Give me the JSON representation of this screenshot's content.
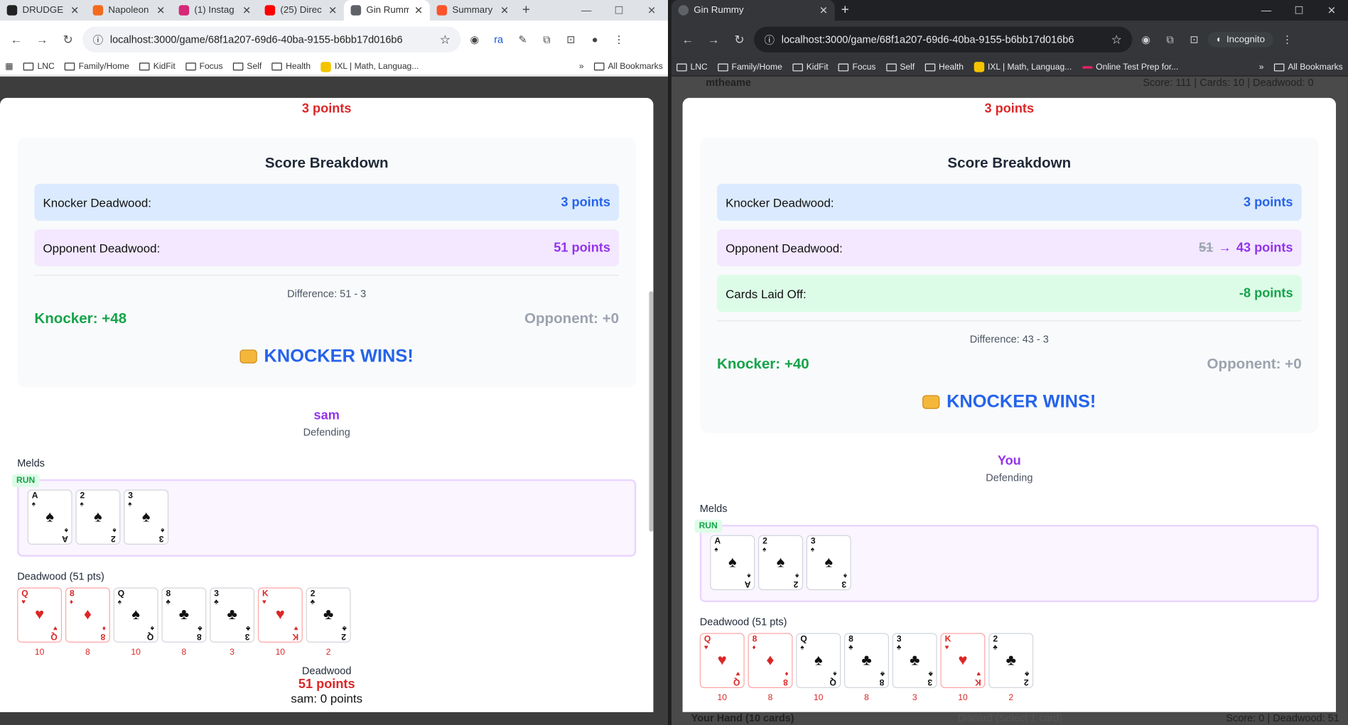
{
  "left_window": {
    "tabs": [
      {
        "title": "DRUDGE",
        "icon": "drudge-icon",
        "color": "#222222"
      },
      {
        "title": "Napoleon",
        "icon": "flame-icon",
        "color": "#f26b1d"
      },
      {
        "title": "(1) Instag",
        "icon": "instagram-icon",
        "color": "#d62976"
      },
      {
        "title": "(25) Direc",
        "icon": "youtube-icon",
        "color": "#ff0000"
      },
      {
        "title": "Gin Rumm",
        "icon": "globe-icon",
        "color": "#5f6368"
      },
      {
        "title": "Summary",
        "icon": "brave-icon",
        "color": "#fb542b"
      }
    ],
    "url": "localhost:3000/game/68f1a207-69d6-40ba-9155-b6bb17d016b6",
    "bookmarks": [
      "LNC",
      "Family/Home",
      "KidFit",
      "Focus",
      "Self",
      "Health",
      "IXL | Math, Languag..."
    ],
    "all_bookmarks": "All Bookmarks",
    "more": "»",
    "extensions": [
      "ra"
    ],
    "modal": {
      "top_points": "3 points",
      "breakdown_title": "Score Breakdown",
      "knocker_label": "Knocker Deadwood:",
      "knocker_value": "3 points",
      "opponent_label": "Opponent Deadwood:",
      "opponent_value": "51 points",
      "difference": "Difference: 51 - 3",
      "knocker_score": "Knocker: +48",
      "opponent_score": "Opponent: +0",
      "wins": "KNOCKER WINS!",
      "player_name": "sam",
      "player_role": "Defending",
      "melds_label": "Melds",
      "run_label": "RUN",
      "deadwood_label": "Deadwood (51 pts)",
      "footer_label": "Deadwood",
      "footer_points": "51 points",
      "footer_sam": "sam: 0 points"
    }
  },
  "right_window": {
    "tab_title": "Gin Rummy",
    "url": "localhost:3000/game/68f1a207-69d6-40ba-9155-b6bb17d016b6",
    "incognito": "Incognito",
    "bookmarks": [
      "LNC",
      "Family/Home",
      "KidFit",
      "Focus",
      "Self",
      "Health",
      "IXL | Math, Languag...",
      "Online Test Prep for..."
    ],
    "all_bookmarks": "All Bookmarks",
    "more": "»",
    "modal": {
      "top_points": "3 points",
      "breakdown_title": "Score Breakdown",
      "knocker_label": "Knocker Deadwood:",
      "knocker_value": "3 points",
      "opponent_label": "Opponent Deadwood:",
      "opponent_old": "51",
      "opponent_arrow": "→",
      "opponent_value": "43 points",
      "laid_off_label": "Cards Laid Off:",
      "laid_off_value": "-8 points",
      "difference": "Difference: 43 - 3",
      "knocker_score": "Knocker: +40",
      "opponent_score": "Opponent: +0",
      "wins": "KNOCKER WINS!",
      "player_name": "You",
      "player_role": "Defending",
      "melds_label": "Melds",
      "run_label": "RUN",
      "deadwood_label": "Deadwood (51 pts)"
    },
    "peek_top": "mtheame",
    "peek_top_right": "Score: 111 | Cards: 10 | Deadwood: 0",
    "peek_bottom_left": "Your Hand (10 cards)",
    "peek_bottom_mid": "Discard (Select 1 card)",
    "peek_bottom_right": "Score: 0 | Deadwood: 51"
  },
  "meld_cards": [
    {
      "rank": "A",
      "suit": "♠",
      "color": "black"
    },
    {
      "rank": "2",
      "suit": "♠",
      "color": "black"
    },
    {
      "rank": "3",
      "suit": "♠",
      "color": "black"
    }
  ],
  "deadwood_cards": [
    {
      "rank": "Q",
      "suit": "♥",
      "color": "red",
      "points": "10"
    },
    {
      "rank": "8",
      "suit": "♦",
      "color": "red",
      "points": "8"
    },
    {
      "rank": "Q",
      "suit": "♠",
      "color": "black",
      "points": "10"
    },
    {
      "rank": "8",
      "suit": "♣",
      "color": "black",
      "points": "8"
    },
    {
      "rank": "3",
      "suit": "♣",
      "color": "black",
      "points": "3"
    },
    {
      "rank": "K",
      "suit": "♥",
      "color": "red",
      "points": "10"
    },
    {
      "rank": "2",
      "suit": "♣",
      "color": "black",
      "points": "2"
    }
  ]
}
